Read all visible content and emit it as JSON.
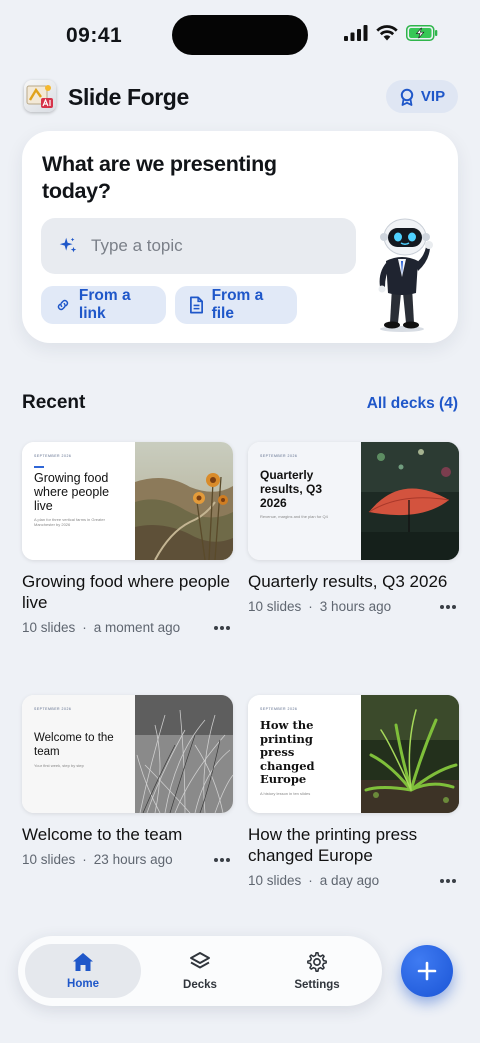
{
  "status_bar": {
    "time": "09:41"
  },
  "header": {
    "app_title": "Slide Forge",
    "vip_label": "VIP"
  },
  "hero": {
    "title": "What are we presenting today?",
    "input_placeholder": "Type a topic",
    "from_link_label": "From a link",
    "from_file_label": "From a file"
  },
  "recent": {
    "title": "Recent",
    "all_decks_label": "All decks (4)"
  },
  "decks": [
    {
      "title": "Growing food where people live",
      "slides": "10 slides",
      "time": "a moment ago",
      "thumb": {
        "date": "SEPTEMBER 2026",
        "title": "Growing food where people live",
        "subtitle": "A plan for three vertical farms in Greater Manchester by 2026",
        "style": "sans"
      }
    },
    {
      "title": "Quarterly results, Q3 2026",
      "slides": "10 slides",
      "time": "3 hours ago",
      "thumb": {
        "date": "SEPTEMBER 2026",
        "title": "Quarterly results, Q3 2026",
        "subtitle": "Revenue, margins and the plan for Q4",
        "style": "bold"
      }
    },
    {
      "title": "Welcome to the team",
      "slides": "10 slides",
      "time": "23 hours ago",
      "thumb": {
        "date": "SEPTEMBER 2026",
        "title": "Welcome to the team",
        "subtitle": "Your first week, step by step",
        "style": "sans"
      }
    },
    {
      "title": "How the printing press changed Europe",
      "slides": "10 slides",
      "time": "a day ago",
      "thumb": {
        "date": "SEPTEMBER 2026",
        "title": "How the printing press changed Europe",
        "subtitle": "A history lesson in ten slides",
        "style": "serif"
      }
    }
  ],
  "bottom_nav": {
    "home": "Home",
    "decks": "Decks",
    "settings": "Settings"
  },
  "colors": {
    "accent": "#1f57c9",
    "background": "#eef1f6",
    "card": "#ffffff"
  },
  "icons": [
    "sparkle-icon",
    "link-icon",
    "file-icon",
    "vip-badge-icon",
    "home-icon",
    "layers-icon",
    "gear-icon",
    "plus-icon",
    "more-icon"
  ]
}
